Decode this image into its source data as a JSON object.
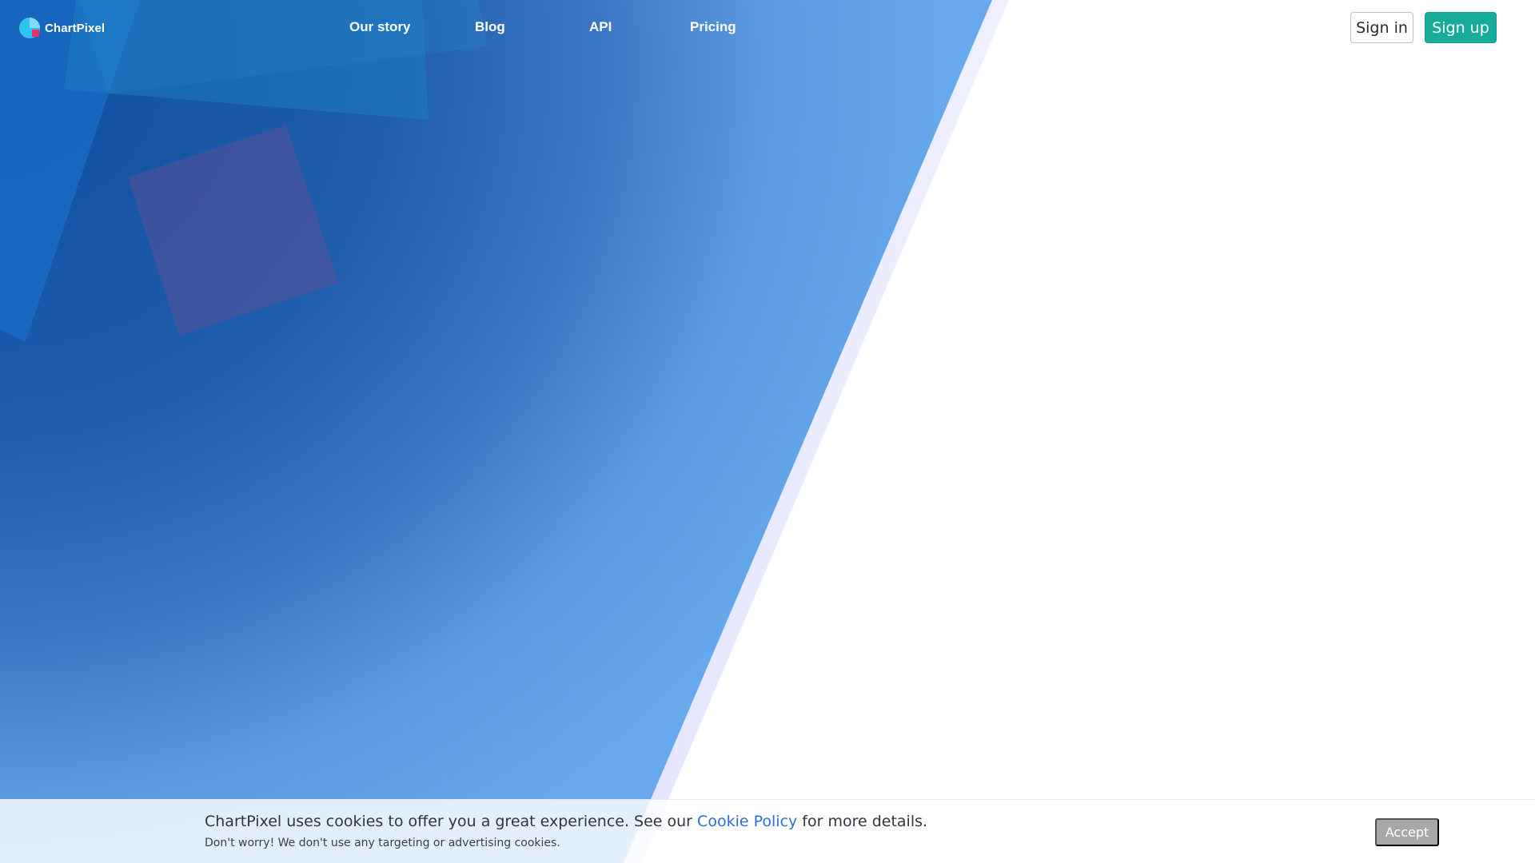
{
  "brand": {
    "name": "ChartPixel",
    "logo_icon": "chartpixel-logo-icon",
    "colors": {
      "hero_blue": "#1e5cad",
      "hero_light_blue": "#68a9ee",
      "signup_teal": "#16ac99",
      "link_blue": "#2c6fd6"
    }
  },
  "nav": {
    "items": [
      {
        "label": "Our story"
      },
      {
        "label": "Blog"
      },
      {
        "label": "API"
      },
      {
        "label": "Pricing"
      }
    ]
  },
  "auth": {
    "sign_in_label": "Sign in",
    "sign_up_label": "Sign up"
  },
  "cookie_banner": {
    "text_before_link": "ChartPixel uses cookies to offer you a great experience. See our ",
    "link_label": "Cookie Policy",
    "text_after_link": " for more details.",
    "subtext": "Don't worry! We don't use any targeting or advertising cookies.",
    "accept_label": "Accept"
  }
}
